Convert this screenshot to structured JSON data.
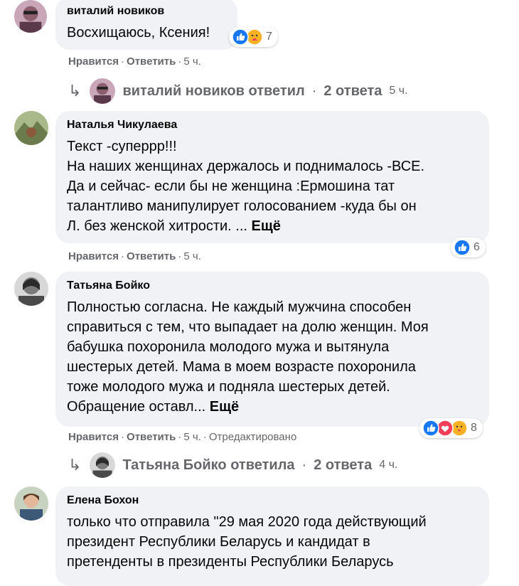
{
  "comments": [
    {
      "author": "виталий новиков",
      "lines": [
        "Восхищаюсь, Ксения!"
      ],
      "more": "",
      "actions": {
        "like": "Нравится",
        "reply": "Ответить",
        "time": "5 ч.",
        "edited": ""
      },
      "reactions": {
        "icons": [
          "like-icon",
          "care-icon"
        ],
        "count": "7"
      },
      "reply_summary": {
        "text": "виталий новиков ответил",
        "count": "2 ответа",
        "time": "5 ч."
      }
    },
    {
      "author": "Наталья Чикулаева",
      "lines": [
        "Текст -суперрр!!!",
        "На наших женщинах держалось и поднималось -ВСЕ.",
        "Да и сейчас- если бы не женщина :Ермошина тат",
        "талантливо манипулирует голосованием -куда бы он",
        "Л. без женской хитрости. ..."
      ],
      "more": "Ещё",
      "actions": {
        "like": "Нравится",
        "reply": "Ответить",
        "time": "5 ч.",
        "edited": ""
      },
      "reactions": {
        "icons": [
          "like-icon"
        ],
        "count": "6"
      }
    },
    {
      "author": "Татьяна Бойко",
      "lines": [
        "Полностью согласна. Не каждый мужчина способен",
        "справиться с тем, что выпадает на долю женщин. Моя",
        "бабушка похоронила молодого мужа и вытянула",
        "шестерых детей. Мама в моем возрасте похоронила",
        "тоже молодого мужа и подняла шестерых детей.",
        "Обращение оставл..."
      ],
      "more": "Ещё",
      "actions": {
        "like": "Нравится",
        "reply": "Ответить",
        "time": "5 ч.",
        "edited": "Отредактировано"
      },
      "reactions": {
        "icons": [
          "like-icon",
          "love-icon",
          "care-icon"
        ],
        "count": "8"
      },
      "reply_summary": {
        "text": "Татьяна Бойко ответила",
        "count": "2 ответа",
        "time": "4 ч."
      }
    },
    {
      "author": "Елена Бохон",
      "lines": [
        "только что отправила \"29 мая 2020 года действующий",
        "президент Республики Беларусь и кандидат в",
        "претенденты в президенты Республики Беларусь"
      ],
      "more": ""
    }
  ],
  "colors": {
    "like": "#1877f2",
    "love": "#f33e58",
    "care": "#f7b125",
    "bubble": "#f0f2f5",
    "meta": "#65676b"
  }
}
